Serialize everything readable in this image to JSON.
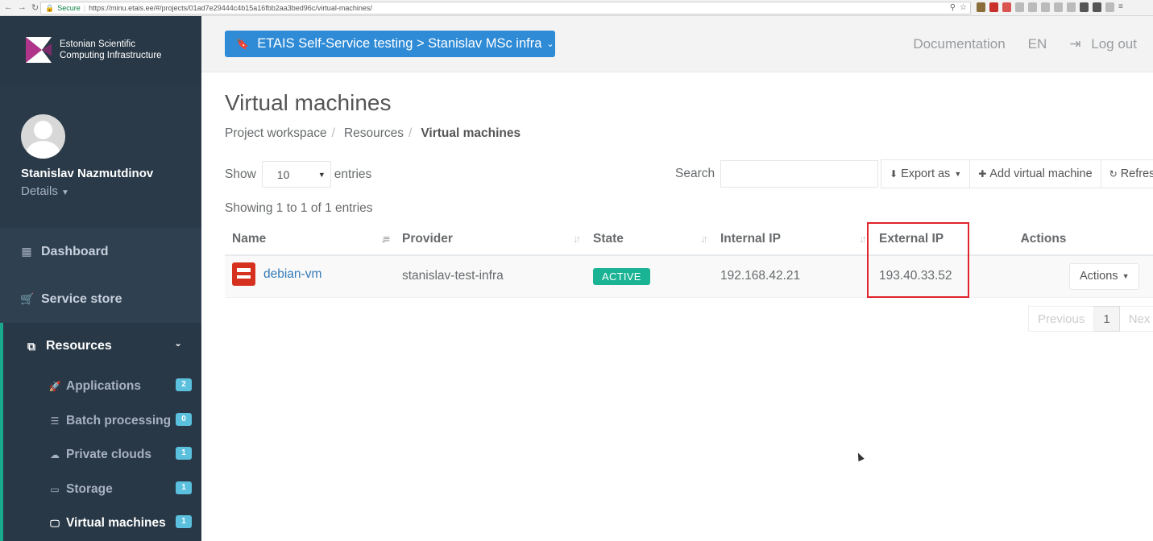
{
  "browser": {
    "secure_label": "Secure",
    "url": "https://minu.etais.ee/#/projects/01ad7e29444c4b15a16fbb2aa3bed96c/virtual-machines/"
  },
  "brand": {
    "line1": "Estonian Scientific",
    "line2": "Computing Infrastructure"
  },
  "user": {
    "name": "Stanislav Nazmutdinov",
    "details_label": "Details"
  },
  "sidebar": {
    "items": [
      {
        "label": "Dashboard",
        "icon": "dashboard-icon"
      },
      {
        "label": "Service store",
        "icon": "cart-icon"
      },
      {
        "label": "Resources",
        "icon": "resources-icon"
      }
    ],
    "sub_items": [
      {
        "label": "Applications",
        "count": "2",
        "icon": "rocket-icon"
      },
      {
        "label": "Batch processing",
        "count": "0",
        "icon": "server-icon"
      },
      {
        "label": "Private clouds",
        "count": "1",
        "icon": "cloud-icon"
      },
      {
        "label": "Storage",
        "count": "1",
        "icon": "hdd-icon"
      },
      {
        "label": "Virtual machines",
        "count": "1",
        "icon": "desktop-icon"
      }
    ]
  },
  "topbar": {
    "project_label": "ETAIS Self-Service testing > Stanislav MSc infra",
    "documentation": "Documentation",
    "language": "EN",
    "logout": "Log out"
  },
  "page": {
    "title": "Virtual machines",
    "breadcrumb": [
      "Project workspace",
      "Resources",
      "Virtual machines"
    ]
  },
  "table_controls": {
    "show_label": "Show",
    "entries_value": "10",
    "entries_label": "entries",
    "search_label": "Search",
    "export_label": "Export as",
    "add_label": "Add virtual machine",
    "refresh_label": "Refres",
    "showing_text": "Showing 1 to 1 of 1 entries"
  },
  "table": {
    "columns": [
      "Name",
      "Provider",
      "State",
      "Internal IP",
      "External IP",
      "Actions"
    ],
    "rows": [
      {
        "name": "debian-vm",
        "provider": "stanislav-test-infra",
        "state": "ACTIVE",
        "internal_ip": "192.168.42.21",
        "external_ip": "193.40.33.52",
        "actions_label": "Actions"
      }
    ]
  },
  "pagination": {
    "previous": "Previous",
    "page": "1",
    "next": "Nex"
  },
  "colors": {
    "sidebar": "#2f4050",
    "accent": "#1ab394",
    "primary": "#2f8bd6",
    "highlight": "#e0242b"
  }
}
